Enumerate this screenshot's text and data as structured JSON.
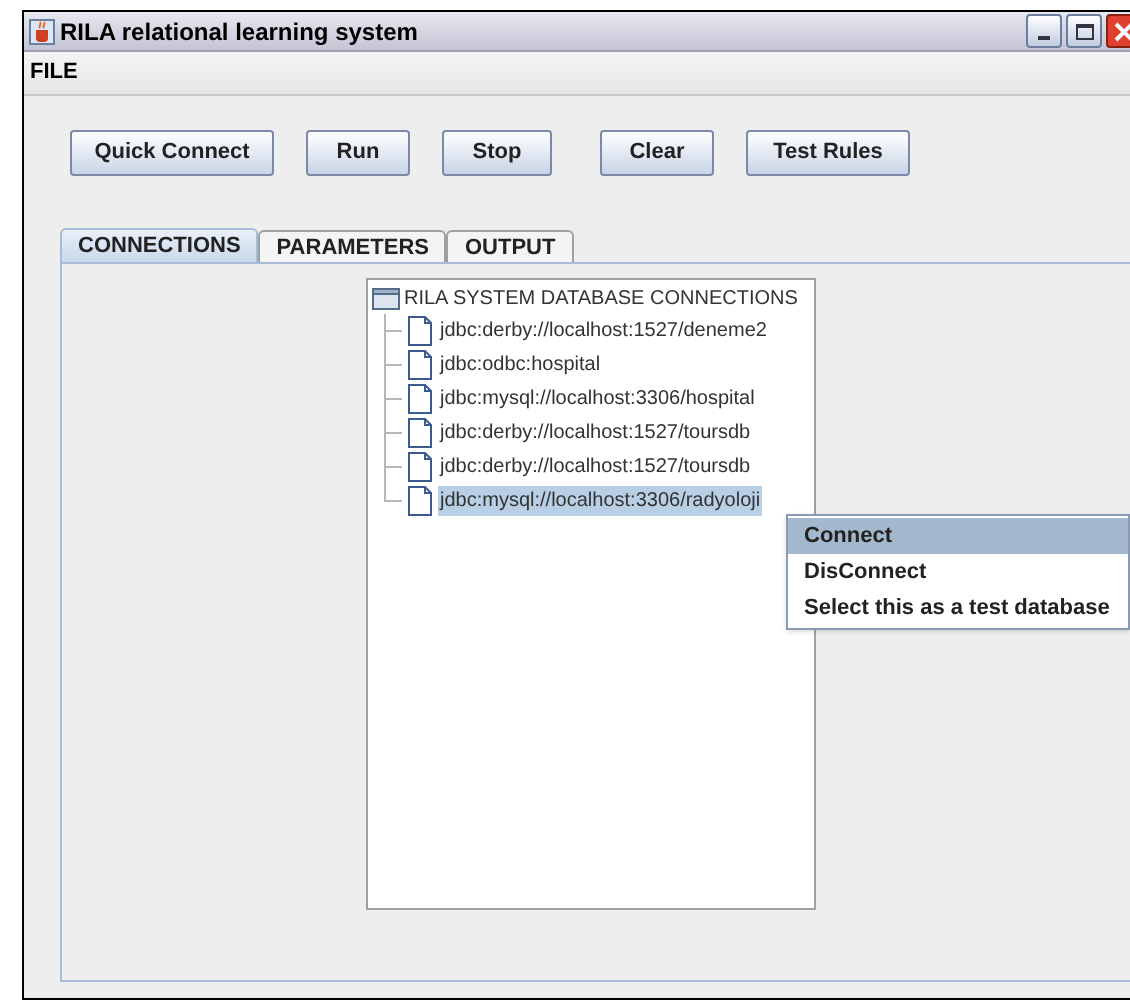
{
  "window": {
    "title": "RILA relational learning system"
  },
  "menu_bar": [
    "FILE"
  ],
  "toolbar": [
    "Quick Connect",
    "Run",
    "Stop",
    "Clear",
    "Test Rules"
  ],
  "tabs": [
    {
      "label": "CONNECTIONS",
      "selected": true
    },
    {
      "label": "PARAMETERS",
      "selected": false
    },
    {
      "label": "OUTPUT",
      "selected": false
    }
  ],
  "tree": {
    "label": "RILA SYSTEM DATABASE CONNECTIONS",
    "children": [
      {
        "label": "jdbc:derby://localhost:1527/deneme2",
        "selected": false
      },
      {
        "label": "jdbc:odbc:hospital",
        "selected": false
      },
      {
        "label": "jdbc:mysql://localhost:3306/hospital",
        "selected": false
      },
      {
        "label": "jdbc:derby://localhost:1527/toursdb",
        "selected": false
      },
      {
        "label": "jdbc:derby://localhost:1527/toursdb",
        "selected": false
      },
      {
        "label": "jdbc:mysql://localhost:3306/radyoloji",
        "selected": true
      }
    ]
  },
  "context_menu": [
    {
      "label": "Connect",
      "selected": true
    },
    {
      "label": "DisConnect",
      "selected": false
    },
    {
      "label": "Select this as a test database",
      "selected": false
    }
  ]
}
